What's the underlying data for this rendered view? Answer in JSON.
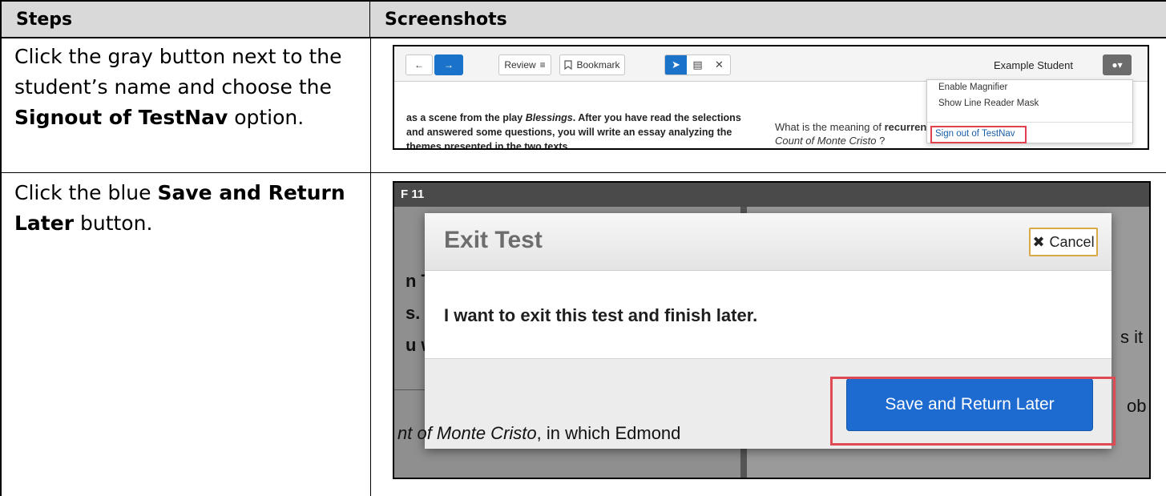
{
  "table": {
    "header_steps": "Steps",
    "header_screenshots": "Screenshots"
  },
  "rows": [
    {
      "step_line1": "Click the gray button next to the",
      "step_line2": "student’s name and choose the",
      "step_bold": "Signout of TestNav",
      "step_tail": " option."
    },
    {
      "step_pre": "Click the blue ",
      "step_bold": "Save and Return",
      "step_bold2": "Later",
      "step_tail": " button."
    }
  ],
  "screenshot1": {
    "review_label": "Review",
    "bookmark_label": "Bookmark",
    "student_name": "Example Student",
    "menu": {
      "item1": "Enable Magnifier",
      "item2": "Show Line Reader Mask",
      "signout": "Sign out of TestNav"
    },
    "passage": {
      "line1_pre": "as a scene from the play ",
      "line1_italic": "Blessings",
      "line1_post": ". After you have read the selections",
      "line2": "and answered some questions, you will write an essay analyzing the",
      "line3": "themes presented in the two texts."
    },
    "question": {
      "pre": "What is the meaning of ",
      "bold": "recurrence",
      "line2_italic": "Count of Monte Cristo",
      "line2_post": " ?"
    }
  },
  "screenshot2": {
    "top_label": "F 11",
    "modal_title": "Exit Test",
    "cancel_label": "Cancel",
    "message": "I want to exit this test and finish later.",
    "save_label": "Save and Return Later",
    "bg_fragments": {
      "f1": "n T",
      "f2": "s. A",
      "f3": "u w",
      "f4": "s it",
      "f5": "ob",
      "f6_italic": "nt of Monte Cristo",
      "f6_rest": ", in which Edmond"
    }
  },
  "colors": {
    "accent_blue": "#1d6bd0",
    "highlight_red": "#e04a52",
    "header_gray": "#d9d9d9"
  }
}
